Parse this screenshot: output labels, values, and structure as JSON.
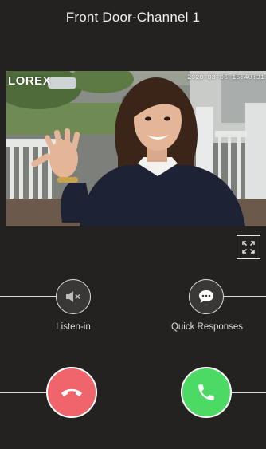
{
  "header": {
    "title": "Front Door-Channel 1"
  },
  "video": {
    "logo_text": "LOREX",
    "timestamp": "2020-08-06 15:40:31"
  },
  "controls": {
    "listen_label": "Listen-in",
    "quick_responses_label": "Quick Responses",
    "fullscreen_icon": "expand-icon",
    "listen_icon": "speaker-muted-icon",
    "quick_icon": "chat-bubble-icon",
    "decline_icon": "phone-hangup-icon",
    "accept_icon": "phone-icon"
  },
  "colors": {
    "background": "#242220",
    "decline": "#f0646b",
    "accept": "#4cd964"
  }
}
